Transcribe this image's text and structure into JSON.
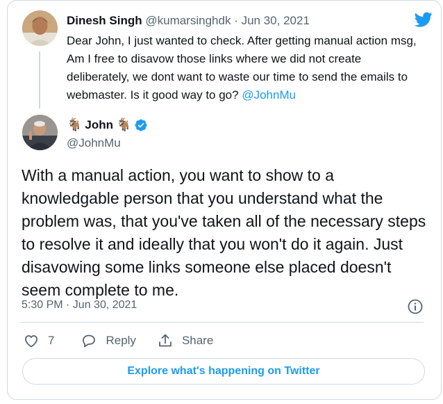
{
  "reply_tweet": {
    "display_name": "Dinesh Singh",
    "handle": "@kumarsinghdk",
    "separator": "·",
    "date": "Jun 30, 2021",
    "text": "Dear John, I just wanted to check. After getting manual action msg, Am I free to disavow those links where we did not create deliberately, we dont want to waste our  time to send the emails to webmaster. Is it good way to go?",
    "mention": "@JohnMu"
  },
  "main_tweet": {
    "display_name": "John",
    "name_prefix_emoji": "🐐",
    "name_suffix_emoji": "🐐",
    "handle": "@JohnMu",
    "text": "With a manual action, you want to show to a knowledgable person that you understand what the problem was, that you've taken all of the necessary steps to resolve it and ideally that you won't do it again. Just disavowing some links someone else placed doesn't seem complete to me.",
    "timestamp": "5:30 PM · Jun 30, 2021"
  },
  "actions": {
    "like_count": "7",
    "reply_label": "Reply",
    "share_label": "Share"
  },
  "explore_label": "Explore what's happening on Twitter",
  "colors": {
    "brand_blue": "#1d9bf0",
    "secondary_text": "#536471",
    "border": "#cfd9de"
  },
  "icons": [
    "twitter-bird-icon",
    "verified-badge-icon",
    "info-icon",
    "heart-icon",
    "reply-bubble-icon",
    "share-icon"
  ]
}
